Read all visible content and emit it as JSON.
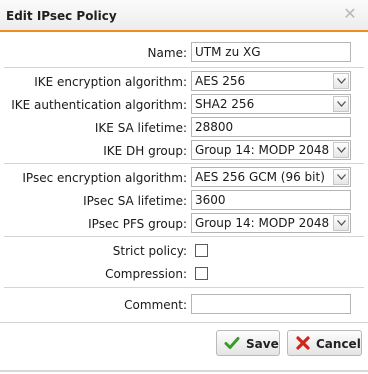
{
  "dialog": {
    "title": "Edit IPsec Policy",
    "close_icon": "close-icon"
  },
  "fields": {
    "name": {
      "label": "Name:",
      "value": "UTM zu XG"
    },
    "ike_encryption": {
      "label": "IKE encryption algorithm:",
      "value": "AES 256"
    },
    "ike_authentication": {
      "label": "IKE authentication algorithm:",
      "value": "SHA2 256"
    },
    "ike_sa_lifetime": {
      "label": "IKE SA lifetime:",
      "value": "28800"
    },
    "ike_dh_group": {
      "label": "IKE DH group:",
      "value": "Group 14: MODP 2048"
    },
    "ipsec_encryption": {
      "label": "IPsec encryption algorithm:",
      "value": "AES 256 GCM (96 bit)"
    },
    "ipsec_sa_lifetime": {
      "label": "IPsec SA lifetime:",
      "value": "3600"
    },
    "ipsec_pfs_group": {
      "label": "IPsec PFS group:",
      "value": "Group 14: MODP 2048"
    },
    "strict_policy": {
      "label": "Strict policy:",
      "checked": false
    },
    "compression": {
      "label": "Compression:",
      "checked": false
    },
    "comment": {
      "label": "Comment:",
      "value": ""
    }
  },
  "buttons": {
    "save": {
      "label": "Save",
      "icon": "checkmark-icon"
    },
    "cancel": {
      "label": "Cancel",
      "icon": "x-icon"
    }
  },
  "colors": {
    "accent": "#f08c1e",
    "save_icon": "#3a9a2a",
    "cancel_icon": "#d0251b"
  }
}
